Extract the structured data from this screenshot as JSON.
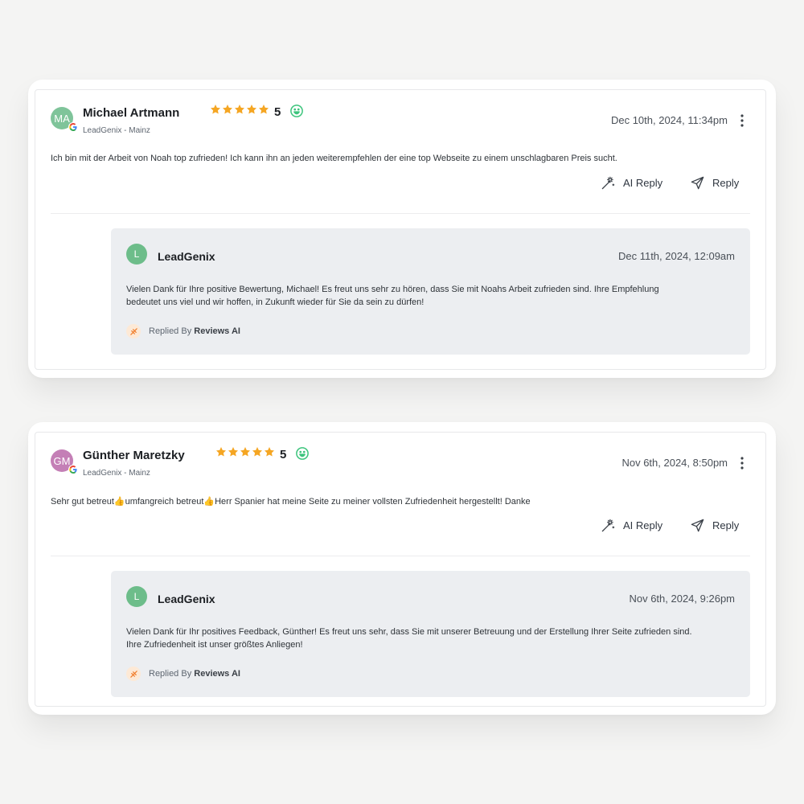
{
  "reviews": [
    {
      "initials": "MA",
      "avatar_color": "#7fc49a",
      "name": "Michael Artmann",
      "location": "LeadGenix - Mainz",
      "rating": "5",
      "stars": 5,
      "date": "Dec 10th, 2024, 11:34pm",
      "text": "Ich bin mit der Arbeit von Noah top zufrieden! Ich kann ihn an jeden weiterempfehlen der eine top Webseite zu einem unschlagbaren Preis sucht.",
      "ai_reply_label": "AI Reply",
      "reply_label": "Reply",
      "reply": {
        "initial": "L",
        "name": "LeadGenix",
        "date": "Dec 11th, 2024, 12:09am",
        "text_line1": "Vielen Dank für Ihre positive Bewertung, Michael! Es freut uns sehr zu hören, dass Sie mit Noahs Arbeit zufrieden sind. Ihre Empfehlung",
        "text_line2": "bedeutet uns viel und wir hoffen, in Zukunft wieder für Sie da sein zu dürfen!",
        "replied_by_prefix": "Replied By",
        "replied_by_name": "Reviews AI"
      }
    },
    {
      "initials": "GM",
      "avatar_color": "#c47fb6",
      "name": "Günther Maretzky",
      "location": "LeadGenix - Mainz",
      "rating": "5",
      "stars": 5,
      "date": "Nov 6th, 2024, 8:50pm",
      "text": "Sehr gut betreut👍umfangreich betreut👍Herr Spanier hat meine Seite zu meiner vollsten Zufriedenheit hergestellt! Danke",
      "ai_reply_label": "AI Reply",
      "reply_label": "Reply",
      "reply": {
        "initial": "L",
        "name": "LeadGenix",
        "date": "Nov 6th, 2024, 9:26pm",
        "text_line1": "Vielen Dank für Ihr positives Feedback, Günther! Es freut uns sehr, dass Sie mit unserer Betreuung und der Erstellung Ihrer Seite zufrieden sind.",
        "text_line2": "Ihre Zufriedenheit ist unser größtes Anliegen!",
        "replied_by_prefix": "Replied By",
        "replied_by_name": "Reviews AI"
      }
    }
  ],
  "colors": {
    "star": "#f5a623",
    "smile": "#3cc47c",
    "ai_accent": "#f07c2a"
  },
  "icons": [
    "google-icon",
    "star-icon",
    "smile-icon",
    "more-vertical-icon",
    "magic-wand-icon",
    "send-icon",
    "ai-sparkle-icon"
  ]
}
